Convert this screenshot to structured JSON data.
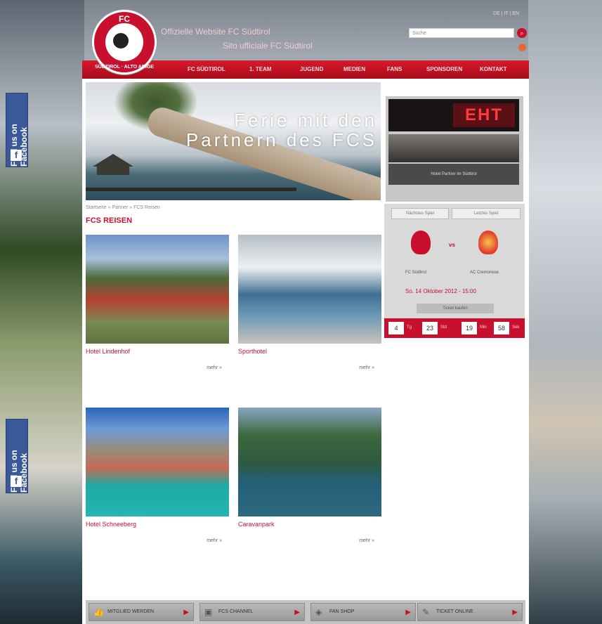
{
  "brand": {
    "logo_top": "FC",
    "logo_ring": "SÜDTIROL · ALTO ADIGE",
    "primary_color": "#c8102e"
  },
  "header": {
    "tagline_line1": "Offizielle Website FC Südtirol",
    "tagline_line2": "Sito ufficiale FC Südtirol",
    "top_links": "DE | IT | EN",
    "search_placeholder": "Suche"
  },
  "nav": {
    "items": [
      "FC Südtirol",
      "1. Team",
      "Jugend",
      "Medien",
      "Fans",
      "Sponsoren",
      "Kontakt"
    ]
  },
  "hero": {
    "title_line1": "Ferie mit den",
    "title_line2": "Partnern des FCS"
  },
  "ad": {
    "logo": "EHT",
    "caption": "Hotel Partner im Südtirol"
  },
  "breadcrumb": "Startseite  »  Partner  »  FCS Reisen",
  "section_title": "FCS REISEN",
  "cards": [
    {
      "name": "Hotel Lindenhof",
      "more": "mehr »"
    },
    {
      "name": "Sporthotel",
      "more": "mehr »"
    },
    {
      "name": "Hotel Schneeberg",
      "more": "mehr »"
    },
    {
      "name": "Caravanpark",
      "more": "mehr »"
    }
  ],
  "match": {
    "tab1": "Nächstes Spiel",
    "tab2": "Letztes Spiel",
    "vs": "vs",
    "home": "FC Südtirol",
    "away": "AC Cremonese",
    "date": "So. 14 Oktober 2012 - 15:00",
    "ticket_label": "Ticket kaufen"
  },
  "countdown": {
    "days": "4",
    "days_unit": "Tg",
    "hours": "23",
    "hours_unit": "Std",
    "minutes": "19",
    "minutes_unit": "Min",
    "seconds": "58",
    "seconds_unit": "Sek"
  },
  "facebook": {
    "label": "Find us on Facebook",
    "icon": "facebook-icon"
  },
  "footer": {
    "buttons": [
      {
        "label": "Mitglied werden",
        "icon": "thumbs-up-icon"
      },
      {
        "label": "FCS Channel",
        "icon": "video-icon"
      },
      {
        "label": "Fan Shop",
        "icon": "shopping-bag-icon"
      },
      {
        "label": "Ticket Online",
        "icon": "ticket-icon"
      }
    ]
  }
}
